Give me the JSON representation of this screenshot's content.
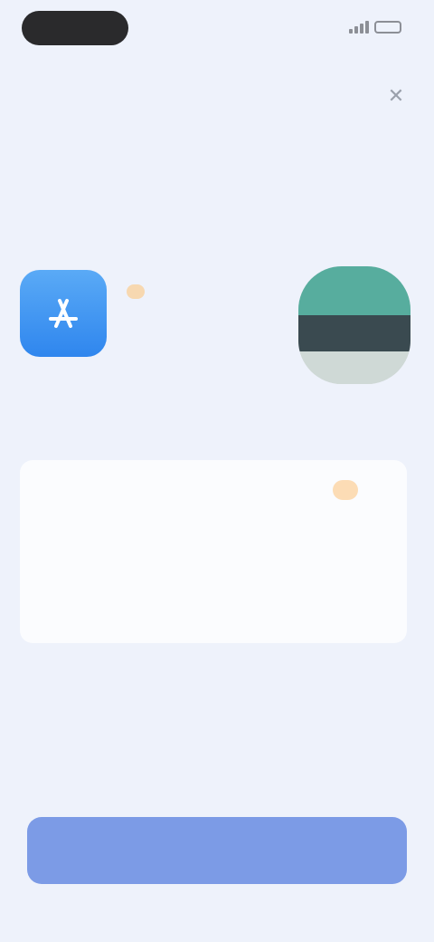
{
  "status_bar": {
    "time": "",
    "battery": ""
  },
  "header": {
    "close_icon": "close-icon",
    "title": "",
    "subtitle": ""
  },
  "apps": {
    "left_icon": "app-store-icon",
    "badge": "",
    "name": "",
    "right_icon": "app-icon"
  },
  "card": {
    "title": "",
    "tag": "",
    "body": ""
  },
  "footer": {
    "link": "",
    "note": "",
    "button_label": ""
  },
  "colors": {
    "background": "#eef2fb",
    "accent": "#4a72d8",
    "button": "#7c9be6",
    "badge": "#fcdcb5"
  }
}
